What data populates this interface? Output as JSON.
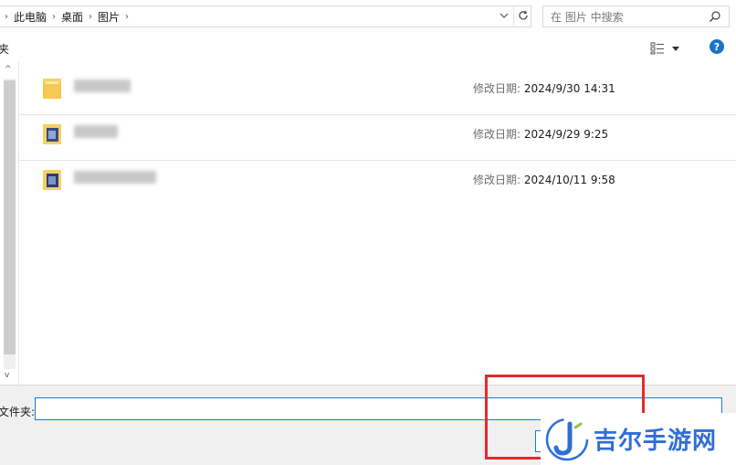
{
  "breadcrumb": {
    "items": [
      "此电脑",
      "桌面",
      "图片"
    ]
  },
  "search": {
    "placeholder": "在 图片 中搜索"
  },
  "toolbar": {
    "left_label": "夹"
  },
  "files": [
    {
      "icon": "folder-icon",
      "modified_label": "修改日期:",
      "modified": "2024/9/30 14:31"
    },
    {
      "icon": "image-folder-icon",
      "modified_label": "修改日期:",
      "modified": "2024/9/29 9:25"
    },
    {
      "icon": "image-folder-icon",
      "modified_label": "修改日期:",
      "modified": "2024/10/11 9:58"
    }
  ],
  "form": {
    "folder_label": "文件夹:",
    "folder_value": ""
  },
  "watermark": {
    "text": "吉尔手游网"
  },
  "colors": {
    "accent": "#1979ca",
    "highlight": "#e32b2b",
    "help": "#1a73c9",
    "watermark": "#2f6ed8"
  }
}
